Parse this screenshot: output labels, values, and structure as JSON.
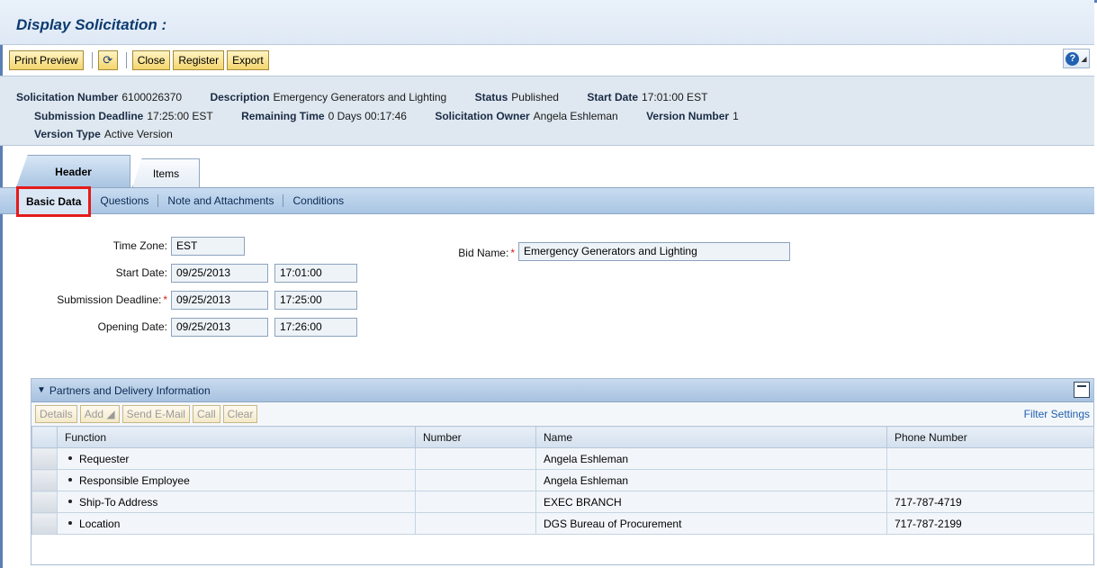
{
  "window": {
    "title": "Display Solicitation :"
  },
  "toolbar": {
    "print_preview": "Print Preview",
    "refresh_icon": "refresh-icon",
    "close": "Close",
    "register": "Register",
    "export": "Export",
    "help_icon": "help-icon",
    "help_glyph": "?",
    "help_arrow": "◢"
  },
  "summary": {
    "solicitation_number_label": "Solicitation Number",
    "solicitation_number": "6100026370",
    "description_label": "Description",
    "description": "Emergency Generators and Lighting",
    "status_label": "Status",
    "status": "Published",
    "start_date_label": "Start Date",
    "start_date": "17:01:00 EST",
    "submission_deadline_label": "Submission Deadline",
    "submission_deadline": "17:25:00 EST",
    "remaining_time_label": "Remaining Time",
    "remaining_time": "0 Days 00:17:46",
    "owner_label": "Solicitation Owner",
    "owner": "Angela Eshleman",
    "version_number_label": "Version Number",
    "version_number": "1",
    "version_type_label": "Version Type",
    "version_type": "Active Version"
  },
  "tabs": [
    {
      "label": "Header",
      "active": true
    },
    {
      "label": "Items",
      "active": false
    }
  ],
  "subtabs": [
    {
      "label": "Basic Data",
      "active": true
    },
    {
      "label": "Questions",
      "active": false
    },
    {
      "label": "Note and Attachments",
      "active": false
    },
    {
      "label": "Conditions",
      "active": false
    }
  ],
  "form": {
    "time_zone_label": "Time Zone:",
    "time_zone": "EST",
    "start_date_label": "Start Date:",
    "start_date": "09/25/2013",
    "start_time": "17:01:00",
    "submission_deadline_label": "Submission Deadline:",
    "submission_date": "09/25/2013",
    "submission_time": "17:25:00",
    "opening_date_label": "Opening Date:",
    "opening_date": "09/25/2013",
    "opening_time": "17:26:00",
    "bid_name_label": "Bid Name:",
    "bid_name": "Emergency Generators and Lighting",
    "required_marker": "*"
  },
  "partners": {
    "title": "Partners and Delivery Information",
    "collapse_icon": "collapse-icon",
    "expand_glyph": "▼",
    "buttons": {
      "details": "Details",
      "add": "Add ◢",
      "send_email": "Send E-Mail",
      "call": "Call",
      "clear": "Clear"
    },
    "filter_settings": "Filter Settings",
    "columns": [
      "Function",
      "Number",
      "Name",
      "Phone Number"
    ],
    "rows": [
      {
        "function": "Requester",
        "number": "",
        "name": "Angela Eshleman",
        "phone": ""
      },
      {
        "function": "Responsible Employee",
        "number": "",
        "name": "Angela Eshleman",
        "phone": ""
      },
      {
        "function": "Ship-To Address",
        "number": "",
        "name": "EXEC BRANCH",
        "phone": "717-787-4719"
      },
      {
        "function": "Location",
        "number": "",
        "name": "DGS Bureau of Procurement",
        "phone": "717-787-2199"
      }
    ]
  },
  "colors": {
    "title": "#0b3a6e",
    "highlight_box": "#e41b1b",
    "required": "#d81b1b",
    "link": "#1f5fb0"
  }
}
